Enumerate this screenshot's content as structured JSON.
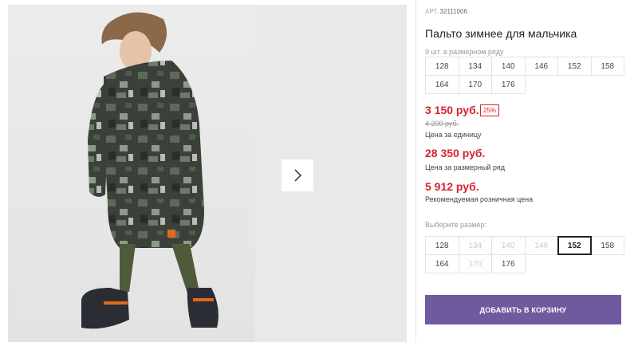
{
  "product": {
    "sku_label": "АРТ.",
    "sku": "32111006",
    "title": "Пальто зимнее для мальчика",
    "pack_count": "9 шт. в размерном ряду"
  },
  "pack_sizes": [
    "128",
    "134",
    "140",
    "146",
    "152",
    "158",
    "164",
    "170",
    "176"
  ],
  "pricing": {
    "unit_price": "3 150 руб.",
    "discount": "25%",
    "old_price": "4 200 руб.",
    "unit_label": "Цена за единицу",
    "range_price": "28 350 руб.",
    "range_label": "Цена за размерный ряд",
    "rrp_price": "5 912 руб.",
    "rrp_label": "Рекомендуемая розничная цена"
  },
  "size_select": {
    "label": "Выберите размер:",
    "sizes": [
      {
        "value": "128",
        "state": "available"
      },
      {
        "value": "134",
        "state": "unavailable"
      },
      {
        "value": "140",
        "state": "unavailable"
      },
      {
        "value": "146",
        "state": "unavailable"
      },
      {
        "value": "152",
        "state": "selected"
      },
      {
        "value": "158",
        "state": "available"
      },
      {
        "value": "164",
        "state": "available"
      },
      {
        "value": "170",
        "state": "unavailable"
      },
      {
        "value": "176",
        "state": "available"
      }
    ]
  },
  "cart": {
    "add_label": "ДОБАВИТЬ В КОРЗИНУ"
  },
  "gallery": {
    "next_icon": "chevron-right-icon"
  },
  "colors": {
    "price_red": "#d6232c",
    "button_purple": "#6f5a9f",
    "selected_border": "#222222"
  }
}
